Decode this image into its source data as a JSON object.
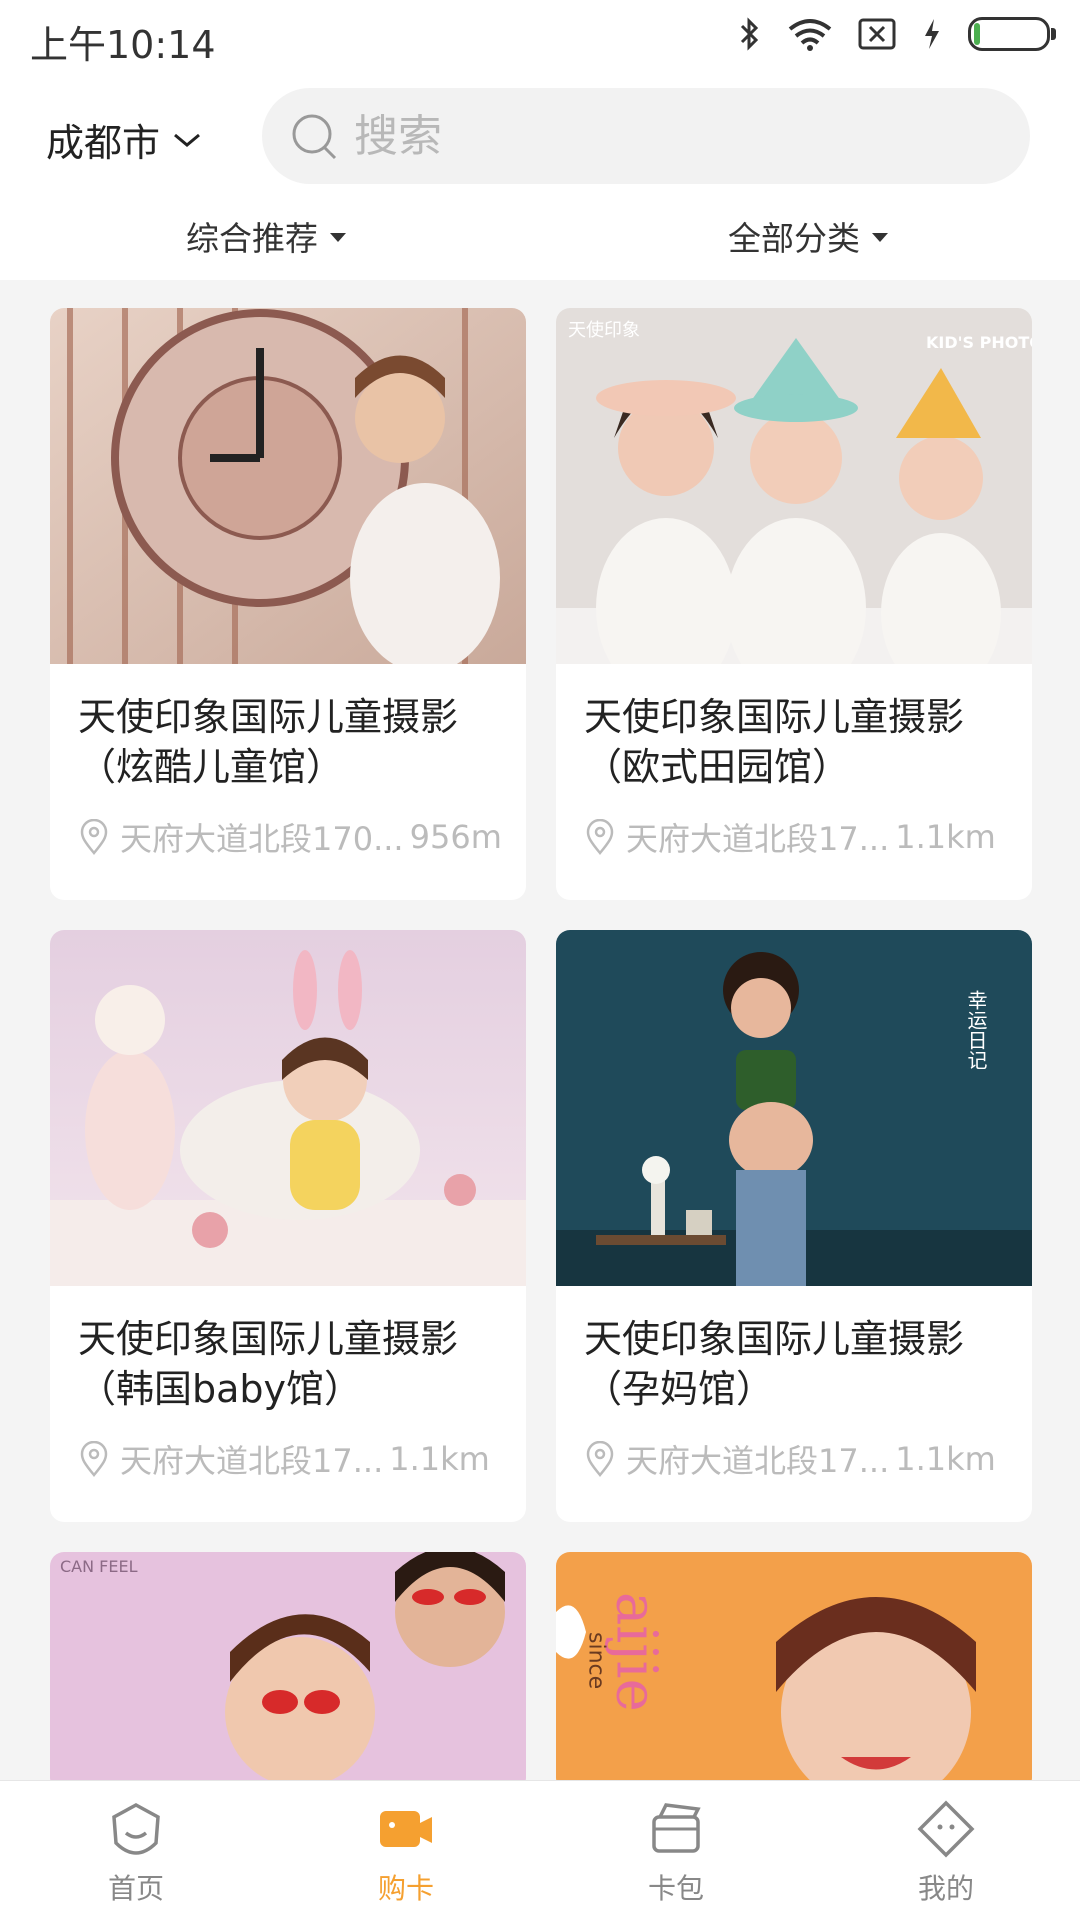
{
  "status_bar": {
    "time": "上午10:14"
  },
  "header": {
    "city": "成都市",
    "search_placeholder": "搜索",
    "filters": [
      "综合推荐",
      "全部分类"
    ]
  },
  "cards": [
    {
      "title": "天使印象国际儿童摄影（炫酷儿童馆）",
      "address": "天府大道北段170...",
      "distance": "956m"
    },
    {
      "title": "天使印象国际儿童摄影（欧式田园馆）",
      "address": "天府大道北段17...",
      "distance": "1.1km",
      "image_text": [
        "天使印象",
        "KID'S PHOTO"
      ]
    },
    {
      "title": "天使印象国际儿童摄影（韩国baby馆）",
      "address": "天府大道北段17...",
      "distance": "1.1km"
    },
    {
      "title": "天使印象国际儿童摄影（孕妈馆）",
      "address": "天府大道北段17...",
      "distance": "1.1km",
      "image_text": [
        "幸运日记"
      ]
    },
    {
      "image_text": [
        "CAN FEEL"
      ]
    },
    {
      "image_text": [
        "aijie",
        "since"
      ]
    }
  ],
  "tabbar": {
    "tabs": [
      {
        "label": "首页",
        "icon": "home-icon"
      },
      {
        "label": "购卡",
        "icon": "buy-card-icon",
        "active": true
      },
      {
        "label": "卡包",
        "icon": "card-wallet-icon"
      },
      {
        "label": "我的",
        "icon": "profile-icon"
      }
    ]
  },
  "colors": {
    "accent": "#f5a030",
    "muted": "#bbbbbb",
    "background": "#f4f4f4"
  }
}
